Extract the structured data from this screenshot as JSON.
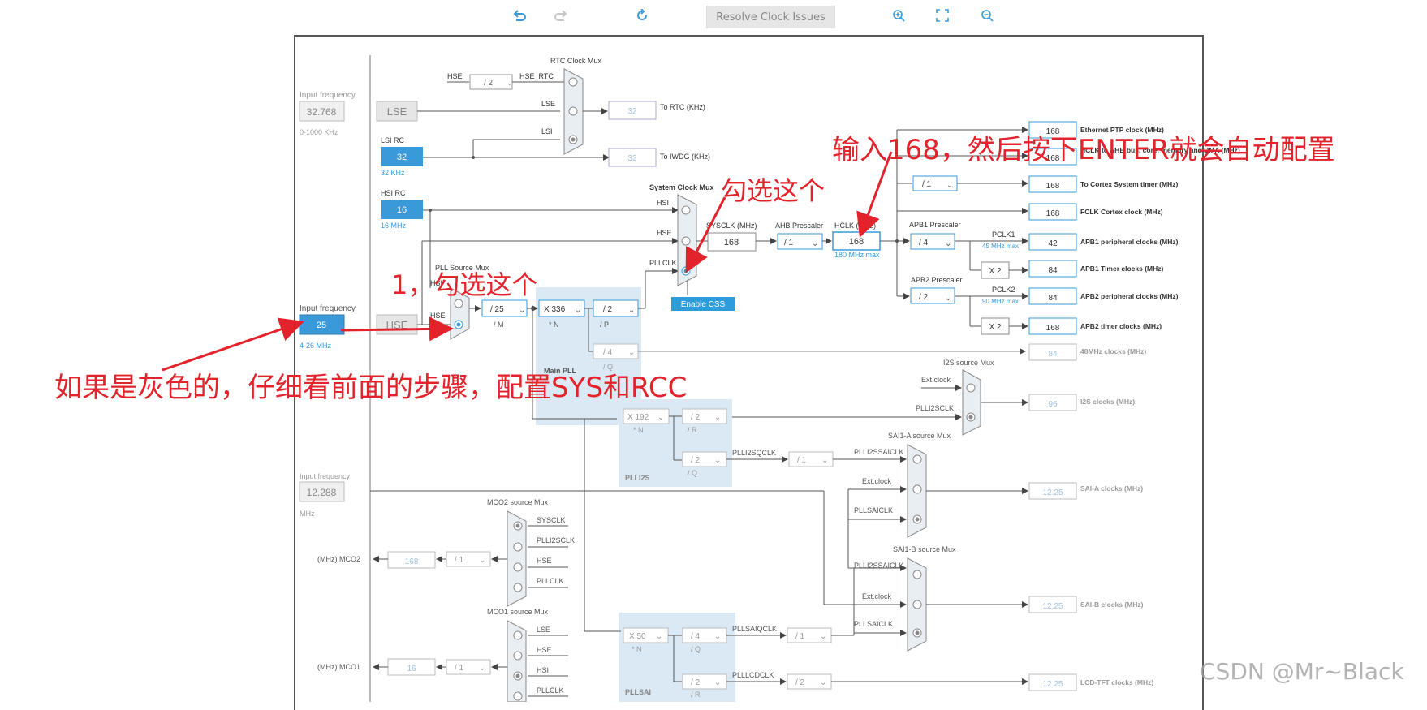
{
  "toolbar": {
    "undo_icon": "undo-icon",
    "redo_icon": "redo-icon",
    "refresh_icon": "refresh-icon",
    "resolve_label": "Resolve Clock Issues",
    "zoom_in_icon": "zoom-in-icon",
    "fit_icon": "fit-screen-icon",
    "zoom_out_icon": "zoom-out-icon"
  },
  "colors": {
    "accent": "#2d9cdb",
    "selected_blue": "#3a9ad9",
    "annotation": "#e3232c",
    "field_border": "#3a9ad9",
    "disabled_text": "#9fc3e0"
  },
  "lse": {
    "input_frequency_label": "Input frequency",
    "value": "32.768",
    "range": "0-1000 KHz",
    "name": "LSE"
  },
  "lsi": {
    "name": "LSI RC",
    "value": "32",
    "sub": "32 KHz"
  },
  "hsi": {
    "name": "HSI RC",
    "value": "16",
    "sub": "16 MHz"
  },
  "hse": {
    "input_frequency_label": "Input frequency",
    "value": "25",
    "range": "4-26 MHz",
    "name": "HSE"
  },
  "rtc": {
    "mux_title": "RTC Clock Mux",
    "hse_label": "HSE",
    "div": "/ 2",
    "hse_rtc": "HSE_RTC",
    "lse_label": "LSE",
    "lsi_label": "LSI",
    "to_rtc_value": "32",
    "to_rtc": "To RTC (KHz)",
    "to_iwdg_value": "32",
    "to_iwdg": "To IWDG (KHz)"
  },
  "pll": {
    "source_mux_title": "PLL Source Mux",
    "hsi_label": "HSI",
    "hse_label": "HSE",
    "m_div": "/ 25",
    "m_label": "/ M",
    "n_mul": "X 336",
    "n_label": "* N",
    "p_div": "/ 2",
    "p_label": "/ P",
    "q_div": "/ 4",
    "q_label": "/ Q",
    "main_pll": "Main PLL"
  },
  "sysclk": {
    "mux_title": "System Clock Mux",
    "hsi": "HSI",
    "hse": "HSE",
    "pllclk": "PLLCLK",
    "enable_css": "Enable CSS",
    "sysclk_label": "SYSCLK (MHz)",
    "sysclk_value": "168",
    "ahb_label": "AHB Prescaler",
    "ahb_value": "/ 1",
    "hclk_label": "HCLK (MHz)",
    "hclk_value": "168",
    "hclk_max": "180 MHz max"
  },
  "apb1": {
    "label": "APB1 Prescaler",
    "value": "/ 4",
    "pclk1": "PCLK1",
    "pclk1_max": "45 MHz max",
    "x2": "X 2"
  },
  "apb2": {
    "label": "APB2 Prescaler",
    "value": "/ 2",
    "pclk2": "PCLK2",
    "pclk2_max": "90 MHz max",
    "x2": "X 2"
  },
  "cortex_div": "/ 1",
  "outputs": [
    {
      "value": "168",
      "label": "Ethernet PTP clock (MHz)"
    },
    {
      "value": "168",
      "label": "HCLK to AHB bus, core, memory and DMA (MHz)"
    },
    {
      "value": "168",
      "label": "To Cortex System timer (MHz)"
    },
    {
      "value": "168",
      "label": "FCLK Cortex clock (MHz)"
    },
    {
      "value": "42",
      "label": "APB1 peripheral clocks (MHz)"
    },
    {
      "value": "84",
      "label": "APB1 Timer clocks (MHz)"
    },
    {
      "value": "84",
      "label": "APB2 peripheral clocks (MHz)"
    },
    {
      "value": "168",
      "label": "APB2 timer clocks (MHz)"
    },
    {
      "value": "84",
      "label": "48MHz clocks (MHz)"
    },
    {
      "value": "96",
      "label": "I2S clocks (MHz)"
    },
    {
      "value": "12.25",
      "label": "SAI-A clocks (MHz)"
    },
    {
      "value": "12.25",
      "label": "SAI-B clocks (MHz)"
    },
    {
      "value": "12.25",
      "label": "LCD-TFT clocks (MHz)"
    }
  ],
  "i2s": {
    "mux_title": "I2S source Mux",
    "ext_clock": "Ext.clock",
    "plli2sclk": "PLLI2SCLK"
  },
  "plli2s": {
    "n": "X 192",
    "n_label": "* N",
    "r": "/ 2",
    "r_label": "/ R",
    "q": "/ 2",
    "q_label": "/ Q",
    "title": "PLLI2S",
    "plli2sqclk": "PLLI2SQCLK",
    "div": "/ 1"
  },
  "saia": {
    "mux_title": "SAI1-A source Mux",
    "plli2ssaiclk": "PLLI2SSAICLK",
    "ext_clock": "Ext.clock",
    "pllsaiclk": "PLLSAICLK"
  },
  "saib": {
    "mux_title": "SAI1-B source Mux",
    "plli2ssaiclk": "PLLI2SSAICLK",
    "ext_clock": "Ext.clock",
    "pllsaiclk": "PLLSAICLK"
  },
  "ext_input": {
    "label": "Input frequency",
    "value": "12.288",
    "unit": "MHz"
  },
  "mco2": {
    "mux_title": "MCO2 source Mux",
    "sysclk": "SYSCLK",
    "plli2sclk": "PLLI2SCLK",
    "hse": "HSE",
    "pllclk": "PLLCLK",
    "label": "(MHz) MCO2",
    "value": "168",
    "div": "/ 1"
  },
  "mco1": {
    "mux_title": "MCO1 source Mux",
    "lse": "LSE",
    "hse": "HSE",
    "hsi": "HSI",
    "pllclk": "PLLCLK",
    "label": "(MHz) MCO1",
    "value": "16",
    "div": "/ 1"
  },
  "pllsai": {
    "n": "X 50",
    "n_label": "* N",
    "q": "/ 4",
    "q_label": "/ Q",
    "r": "/ 2",
    "r_label": "/ R",
    "title": "PLLSAI",
    "pllsaiqclk": "PLLSAIQCLK",
    "qdiv": "/ 1",
    "pllcdclk": "PLLLCDCLK",
    "rdiv": "/ 2"
  },
  "annotations": {
    "step1": "1，勾选这个",
    "check_this": "勾选这个",
    "hclk_note": "输入168，然后按下ENTER就会自动配置",
    "grey_note": "如果是灰色的，仔细看前面的步骤，配置SYS和RCC"
  },
  "watermark": "CSDN @Mr~Black"
}
